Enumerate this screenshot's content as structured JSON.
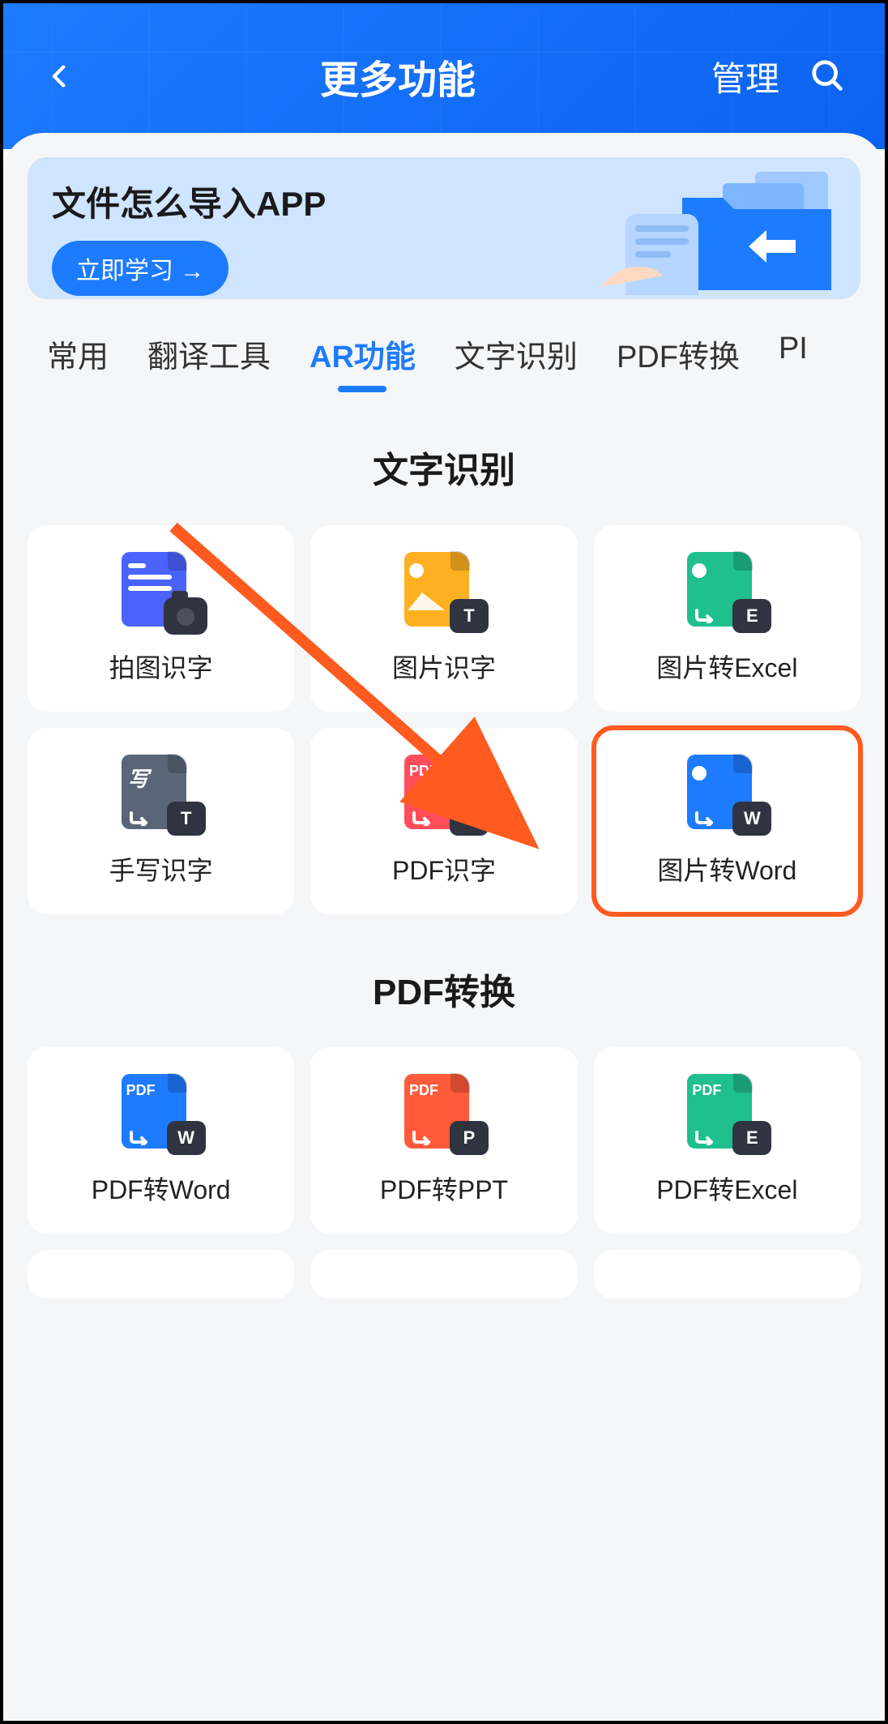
{
  "header": {
    "title": "更多功能",
    "manage": "管理"
  },
  "banner": {
    "title": "文件怎么导入APP",
    "cta": "立即学习 →"
  },
  "tabs": [
    "常用",
    "翻译工具",
    "AR功能",
    "文字识别",
    "PDF转换",
    "PI"
  ],
  "active_tab_index": 2,
  "section1": {
    "title": "文字识别",
    "items": [
      {
        "label": "拍图识字"
      },
      {
        "label": "图片识字"
      },
      {
        "label": "图片转Excel"
      },
      {
        "label": "手写识字"
      },
      {
        "label": "PDF识字"
      },
      {
        "label": "图片转Word"
      }
    ],
    "highlight_index": 5
  },
  "section2": {
    "title": "PDF转换",
    "items": [
      {
        "label": "PDF转Word"
      },
      {
        "label": "PDF转PPT"
      },
      {
        "label": "PDF转Excel"
      }
    ]
  }
}
